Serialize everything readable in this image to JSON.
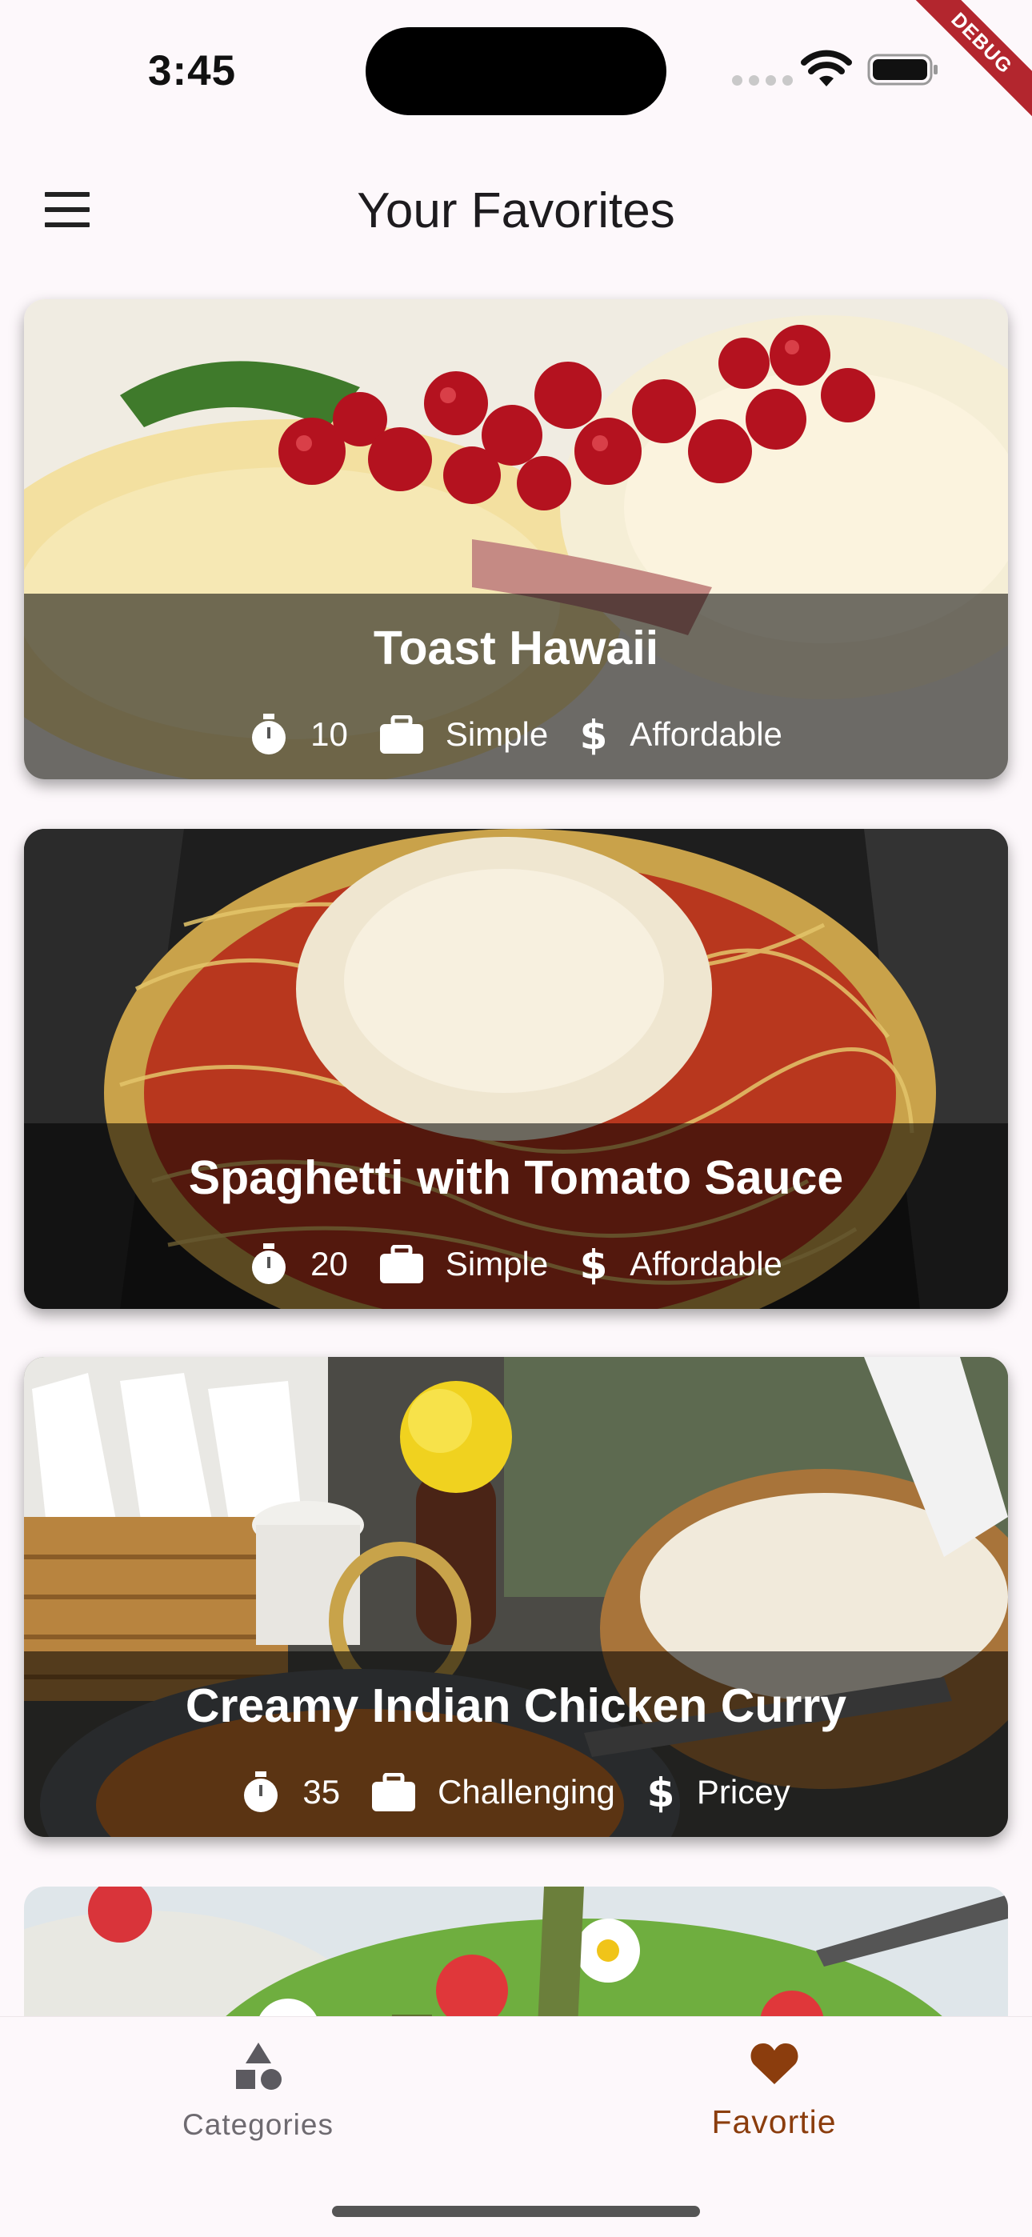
{
  "status_bar": {
    "time": "3:45",
    "debug_banner": "DEBUG",
    "icons": [
      "cellular-icon",
      "wifi-icon",
      "battery-icon"
    ]
  },
  "app_bar": {
    "title": "Your Favorites",
    "menu_icon": "menu-icon"
  },
  "meals": [
    {
      "title": "Toast Hawaii",
      "duration": "10",
      "complexity": "Simple",
      "affordability": "Affordable"
    },
    {
      "title": "Spaghetti with Tomato Sauce",
      "duration": "20",
      "complexity": "Simple",
      "affordability": "Affordable"
    },
    {
      "title": "Creamy Indian Chicken Curry",
      "duration": "35",
      "complexity": "Challenging",
      "affordability": "Pricey"
    }
  ],
  "bottom_nav": {
    "items": [
      {
        "label": "Categories",
        "icon": "categories-icon",
        "selected": false
      },
      {
        "label": "Favortie",
        "icon": "heart-icon",
        "selected": true
      }
    ]
  },
  "colors": {
    "background": "#fdf8fb",
    "accent": "#8b3d0d",
    "overlay": "#000000",
    "debug": "#b3262e"
  }
}
